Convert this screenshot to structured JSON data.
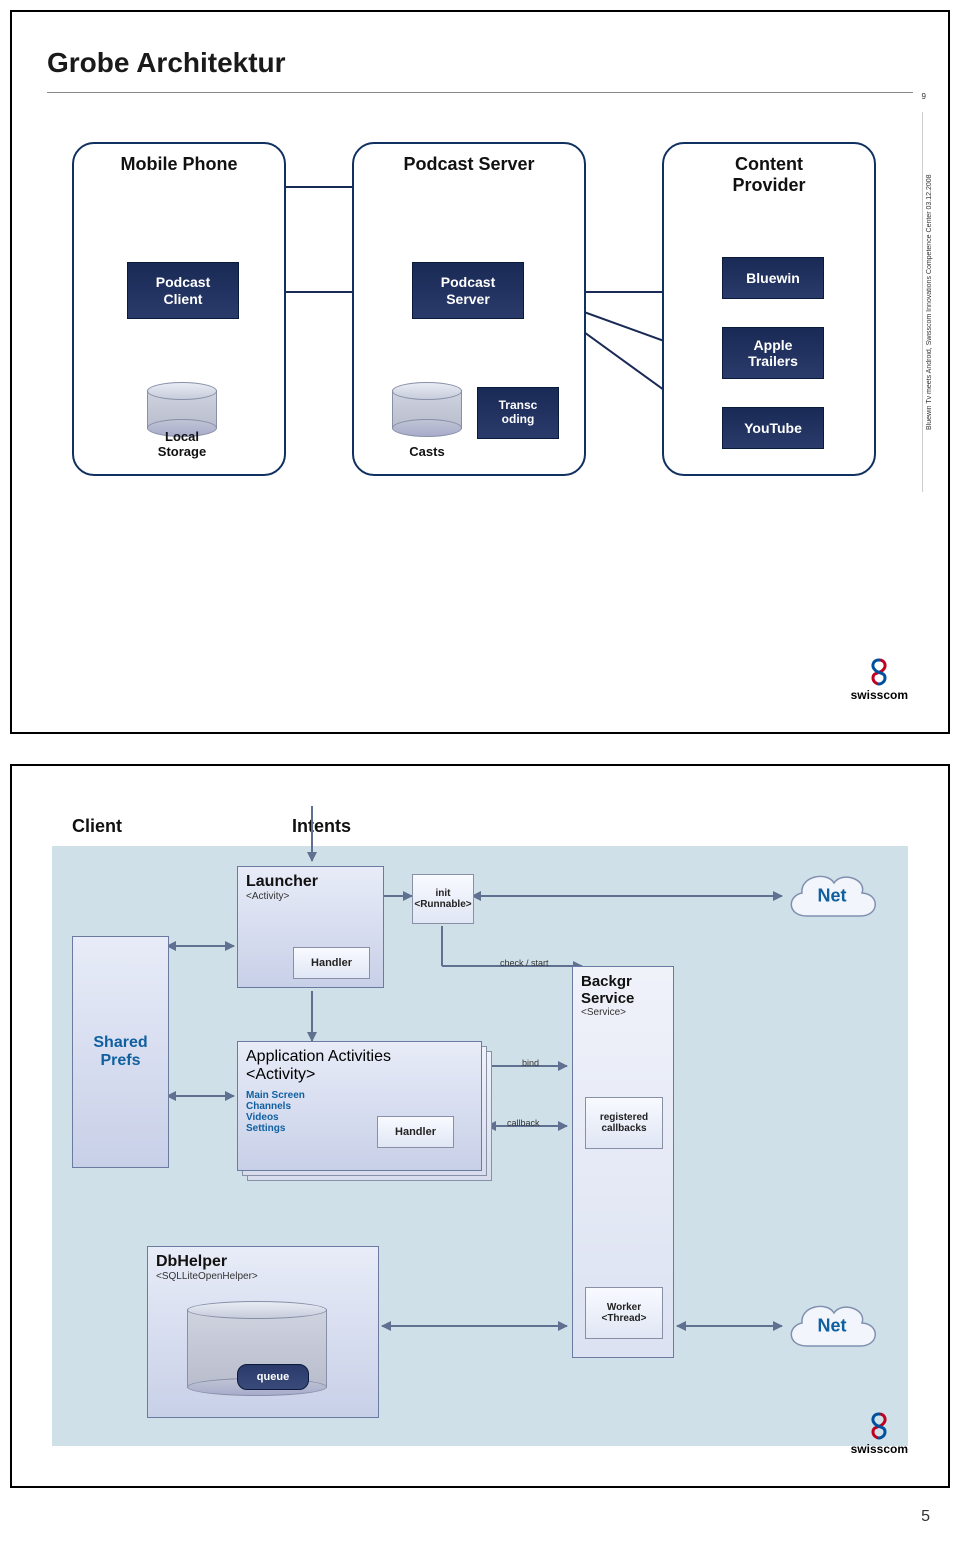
{
  "slide1": {
    "title": "Grobe Architektur",
    "page_num": "9",
    "side_text": "Bluewin Tv meets Android, Swisscom Innovations Competence Center    03.12.2008",
    "groups": {
      "phone": {
        "title": "Mobile Phone",
        "client": "Podcast\nClient",
        "storage": "Local\nStorage"
      },
      "server": {
        "title": "Podcast Server",
        "server": "Podcast\nServer",
        "casts": "Casts",
        "transc": "Transc\noding"
      },
      "provider": {
        "title": "Content\nProvider",
        "bluewin": "Bluewin",
        "apple": "Apple\nTrailers",
        "youtube": "YouTube"
      }
    },
    "logo": "swisscom"
  },
  "slide2": {
    "client_label": "Client",
    "intents_label": "Intents",
    "shared_prefs": "Shared\nPrefs",
    "launcher": {
      "title": "Launcher",
      "sub": "<Activity>",
      "handler": "Handler"
    },
    "init": "init\n<Runnable>",
    "check_start": "check / start",
    "app_act": {
      "title": "Application Activities",
      "sub": "<Activity>",
      "list": "Main Screen\nChannels\nVideos\nSettings",
      "handler": "Handler"
    },
    "bind": "bind",
    "callback": "callback",
    "backgr": {
      "title": "Backgr\nService",
      "sub": "<Service>",
      "reg": "registered\ncallbacks"
    },
    "net": "Net",
    "dbhelper": {
      "title": "DbHelper",
      "sub": "<SQLLiteOpenHelper>",
      "queue": "queue"
    },
    "worker": "Worker\n<Thread>",
    "logo": "swisscom"
  }
}
